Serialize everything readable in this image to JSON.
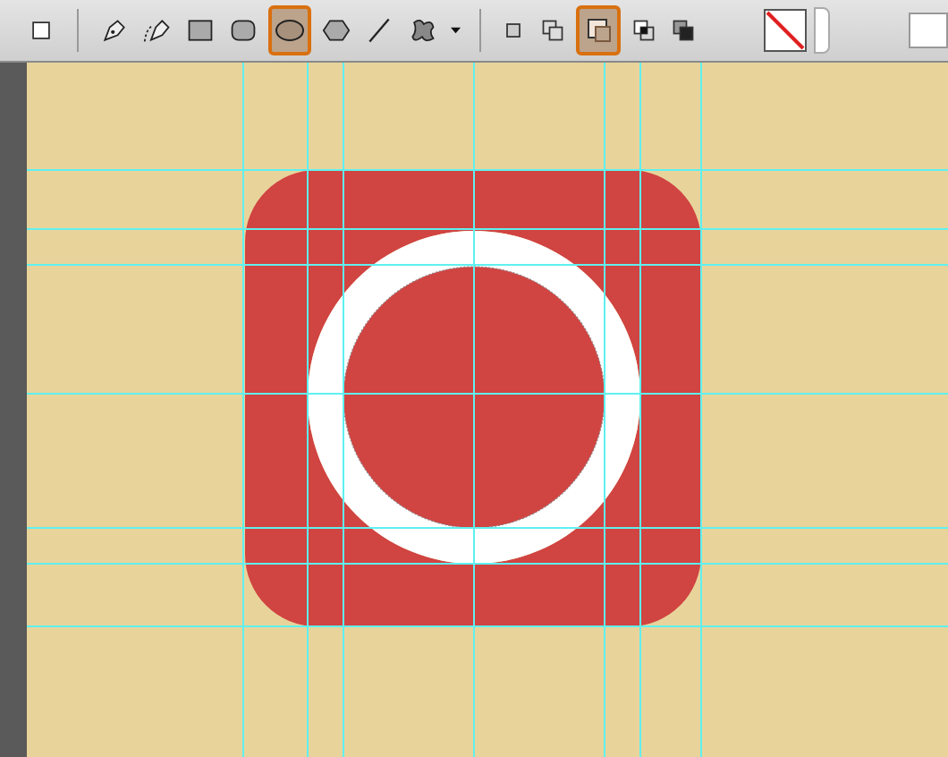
{
  "toolbar": {
    "tools": [
      {
        "kind": "square",
        "selected": false
      },
      {
        "kind": "pen",
        "selected": false
      },
      {
        "kind": "freeform-pen",
        "selected": false
      },
      {
        "kind": "rectangle",
        "selected": false
      },
      {
        "kind": "rounded-rectangle",
        "selected": false
      },
      {
        "kind": "ellipse",
        "selected": true
      },
      {
        "kind": "polygon",
        "selected": false
      },
      {
        "kind": "line",
        "selected": false
      },
      {
        "kind": "custom-shape",
        "selected": false
      }
    ],
    "path_operations": [
      {
        "kind": "new-layer",
        "selected": false
      },
      {
        "kind": "add",
        "selected": false
      },
      {
        "kind": "subtract",
        "selected": true
      },
      {
        "kind": "intersect",
        "selected": false
      },
      {
        "kind": "exclude",
        "selected": false
      }
    ]
  }
}
